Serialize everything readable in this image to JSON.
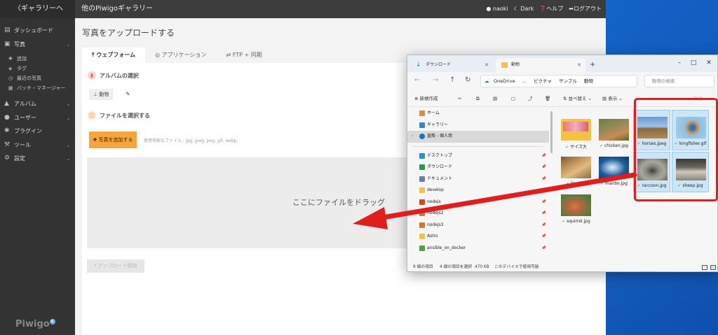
{
  "piwigo": {
    "back_link": "〈ギャラリーへ",
    "gallery_title": "他のPiwigoギャラリー",
    "topbar": {
      "user": "naoki",
      "theme": "Dark",
      "help": "ヘルプ",
      "logout": "ログアウト"
    },
    "sidebar": {
      "items": [
        {
          "label": "ダッシュボード",
          "icon": "dashboard-icon"
        },
        {
          "label": "写真",
          "icon": "photo-icon"
        },
        {
          "label": "アルバム",
          "icon": "album-icon"
        },
        {
          "label": "ユーザー",
          "icon": "users-icon"
        },
        {
          "label": "プラグイン",
          "icon": "puzzle-icon"
        },
        {
          "label": "ツール",
          "icon": "wrench-icon"
        },
        {
          "label": "設定",
          "icon": "gear-icon"
        }
      ],
      "photo_subitems": [
        "追加",
        "タグ",
        "最近の写真",
        "バッチ・マネージャー"
      ],
      "logo": "Piwigo",
      "logo_badge": "6"
    },
    "page_title": "写真をアップロードする",
    "tabs": [
      "ウェブフォーム",
      "アプリケーション",
      "FTP + 同期"
    ],
    "album_section": "アルバムの選択",
    "album_chip": "動物",
    "files_section": "ファイルを選択する",
    "add_photos_button": "写真を追加する",
    "allowed_types": "使用可能なファイル : jpg, jpeg, png, gif, webp,",
    "dropzone_text": "ここにファイルをドラッグ",
    "start_upload_button": "アップロード開始"
  },
  "explorer": {
    "tabs": [
      "ダウンロード",
      "動物"
    ],
    "breadcrumb": [
      "OneDrive",
      "…",
      "ピクチャ",
      "サンプル",
      "動物"
    ],
    "search_placeholder": "動物の検索",
    "toolbar": {
      "new": "新規作成",
      "sort": "並べ替え",
      "view": "表示",
      "details": "詳細"
    },
    "nav": [
      {
        "label": "ホーム",
        "color": "#d8903a"
      },
      {
        "label": "ギャラリー",
        "color": "#3b82d0"
      },
      {
        "label": "直殻 - 個人用",
        "color": "#1a73c9"
      }
    ],
    "quick_access": [
      {
        "label": "デスクトップ",
        "color": "#2f8fd8"
      },
      {
        "label": "ダウンロード",
        "color": "#2a9a4a"
      },
      {
        "label": "ドキュメント",
        "color": "#6b7db3"
      },
      {
        "label": "develop",
        "color": "#f2c14e"
      },
      {
        "label": "nodejs",
        "color": "#d04a2a"
      },
      {
        "label": "nodejs2",
        "color": "#d77a1e"
      },
      {
        "label": "nodejs3",
        "color": "#d77a1e"
      },
      {
        "label": "Astro",
        "color": "#f2c14e"
      },
      {
        "label": "ansible_on_docker",
        "color": "#5aa040"
      }
    ],
    "files": [
      {
        "name": "サイズ大",
        "selected": false,
        "colors": [
          "#f5c142",
          "#e0a82e"
        ]
      },
      {
        "name": "chicken.jpg",
        "selected": false,
        "colors": [
          "#7f8d4a",
          "#c98b52"
        ]
      },
      {
        "name": "horses.jpeg",
        "selected": true,
        "colors": [
          "#6e9ad1",
          "#8a6a3e"
        ]
      },
      {
        "name": "kingfisher.gif",
        "selected": true,
        "colors": [
          "#7ab3d6",
          "#2a6aa5"
        ]
      },
      {
        "name": "lion.jpg",
        "selected": false,
        "colors": [
          "#c99b61",
          "#7a5a32"
        ]
      },
      {
        "name": "manbo.jpg",
        "selected": false,
        "colors": [
          "#1d5d9b",
          "#9fc0e0"
        ]
      },
      {
        "name": "raccoon.jpg",
        "selected": true,
        "colors": [
          "#8b8b84",
          "#3f3d38"
        ]
      },
      {
        "name": "sheep.jpg",
        "selected": true,
        "colors": [
          "#6d6a60",
          "#cfc9bd"
        ]
      },
      {
        "name": "squirrel.jpg",
        "selected": false,
        "colors": [
          "#b7643b",
          "#4f6b3a"
        ]
      }
    ],
    "status": {
      "count": "9 個の項目",
      "selected": "4 個の項目を選択",
      "size": "470 KB",
      "availability": "このデバイスで使用可能"
    }
  },
  "colors": {
    "accent_orange": "#f9a33b",
    "highlight_red": "#e21d1d"
  }
}
